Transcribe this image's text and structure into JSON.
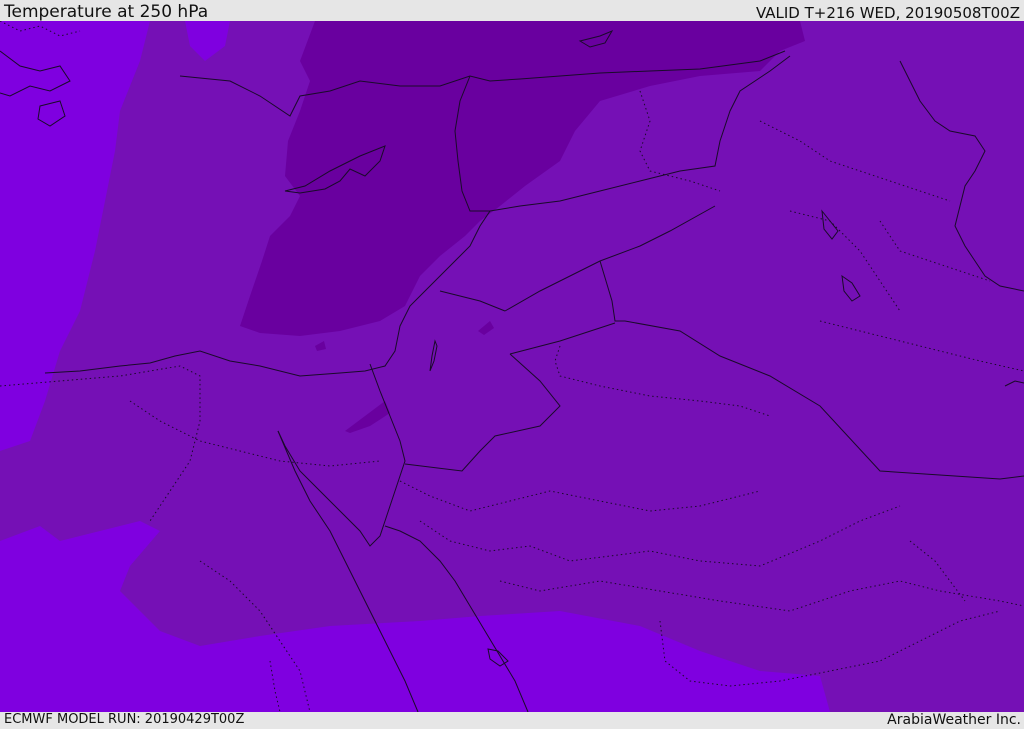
{
  "header": {
    "title": "Temperature at 250 hPa",
    "valid_time": "VALID T+216 WED, 20190508T00Z"
  },
  "footer": {
    "model_run": "ECMWF MODEL RUN: 20190429T00Z",
    "provider": "ArabiaWeather Inc."
  },
  "map": {
    "colors": {
      "cold_band": "#7f00e0",
      "mid_band": "#7510b5",
      "warm_band": "#69009f",
      "coastline": "#1a0a2a"
    }
  }
}
